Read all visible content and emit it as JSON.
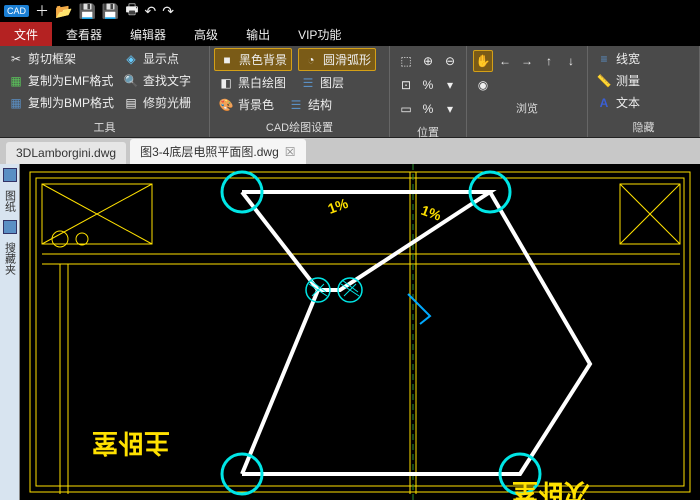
{
  "titlebar": {
    "app": "CAD"
  },
  "menu": {
    "file": "文件",
    "viewer": "查看器",
    "editor": "编辑器",
    "advanced": "高级",
    "output": "输出",
    "vip": "VIP功能"
  },
  "ribbon": {
    "tools": {
      "clip_frame": "剪切框架",
      "copy_emf": "复制为EMF格式",
      "copy_bmp": "复制为BMP格式",
      "show_point": "显示点",
      "find_text": "查找文字",
      "raster": "修剪光栅",
      "label": "工具"
    },
    "cad": {
      "black_bg": "黑色背景",
      "smooth_arc": "圆滑弧形",
      "bw_drawing": "黑白绘图",
      "layer": "图层",
      "bg_color": "背景色",
      "structure": "结构",
      "label": "CAD绘图设置"
    },
    "position": {
      "label": "位置"
    },
    "browse": {
      "label": "浏览"
    },
    "hide": {
      "linewidth": "线宽",
      "measure": "测量",
      "text": "文本",
      "label": "隐藏"
    }
  },
  "tabs": {
    "t1": "3DLamborgini.dwg",
    "t2": "图3-4底层电照平面图.dwg"
  },
  "side": {
    "t1": "图纸",
    "t2": "搜藏夹"
  },
  "canvas": {
    "label1": "主卧室",
    "label2": "次卧室",
    "pct": "1%"
  }
}
